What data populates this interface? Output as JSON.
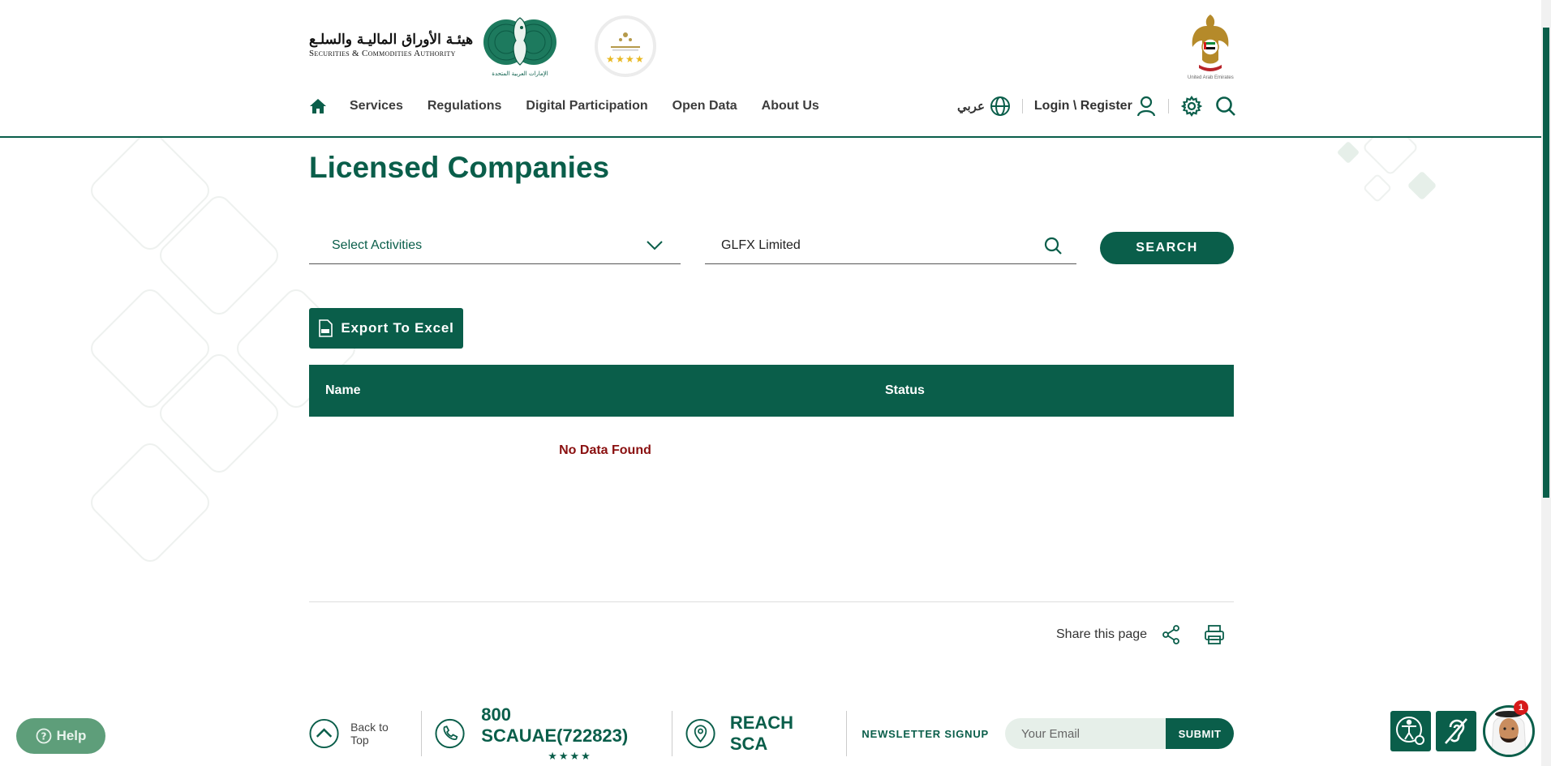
{
  "header": {
    "logo_arabic": "هيئـة الأوراق الماليـة والسلـع",
    "logo_english": "Securities & Commodities Authority",
    "seal_caption": "الإمارات العربية المتحدة",
    "nav": [
      "Services",
      "Regulations",
      "Digital Participation",
      "Open Data",
      "About Us"
    ],
    "language": "عربي",
    "login": "Login \\ Register",
    "emblem_caption": "United Arab Emirates"
  },
  "main": {
    "title": "Licensed Companies",
    "activities_placeholder": "Select Activities",
    "search_value": "GLFX Limited",
    "search_button": "SEARCH",
    "export_button": "Export To Excel",
    "columns": [
      "Name",
      "Status"
    ],
    "empty_message": "No Data Found",
    "share_label": "Share this page"
  },
  "footer": {
    "back_to_top": "Back to Top",
    "phone": "800 SCAUAE(722823)",
    "phone_stars": "★★★★",
    "reach": "REACH SCA",
    "newsletter": "NEWSLETTER SIGNUP",
    "email_placeholder": "Your Email",
    "submit": "SUBMIT"
  },
  "widgets": {
    "help": "Help",
    "notification_count": "1"
  },
  "colors": {
    "brand": "#0a5e4a",
    "error": "#8a1010",
    "badge": "#d61a1a"
  },
  "icons": [
    "home-icon",
    "globe-icon",
    "user-icon",
    "gear-icon",
    "search-icon",
    "chevron-down-icon",
    "excel-icon",
    "share-icon",
    "print-icon",
    "chevron-up-icon",
    "phone-icon",
    "location-pin-icon",
    "help-icon",
    "accessibility-icon",
    "hearing-icon"
  ]
}
